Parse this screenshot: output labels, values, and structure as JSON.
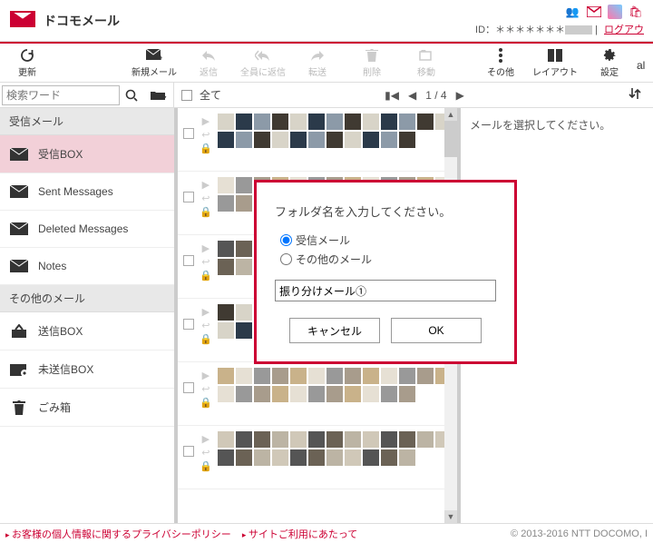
{
  "app": {
    "title": "ドコモメール"
  },
  "header": {
    "id_label": "ID：",
    "id_value": "＊＊＊＊＊＊＊",
    "logout": "ログアウ"
  },
  "toolbar": {
    "refresh": "更新",
    "compose": "新規メール",
    "reply": "返信",
    "reply_all": "全員に返信",
    "forward": "転送",
    "delete": "削除",
    "move": "移動",
    "other": "その他",
    "layout": "レイアウト",
    "settings": "設定",
    "extra": "al"
  },
  "search": {
    "placeholder": "検索ワード"
  },
  "list_header": {
    "all": "全て",
    "pager": "1 / 4"
  },
  "sidebar": {
    "group1_title": "受信メール",
    "items1": [
      {
        "label": "受信BOX"
      },
      {
        "label": "Sent Messages"
      },
      {
        "label": "Deleted Messages"
      },
      {
        "label": "Notes"
      }
    ],
    "group2_title": "その他のメール",
    "items2": [
      {
        "label": "送信BOX"
      },
      {
        "label": "未送信BOX"
      },
      {
        "label": "ごみ箱"
      }
    ]
  },
  "preview": {
    "empty": "メールを選択してください。"
  },
  "modal": {
    "title": "フォルダ名を入力してください。",
    "radio1": "受信メール",
    "radio2": "その他のメール",
    "input_value": "振り分けメール①",
    "cancel": "キャンセル",
    "ok": "OK"
  },
  "footer": {
    "link1": "お客様の個人情報に関するプライバシーポリシー",
    "link2": "サイトご利用にあたって",
    "copyright": "© 2013-2016 NTT DOCOMO, I"
  },
  "mosaic": {
    "palette": [
      "#d8d4c8",
      "#a89c8c",
      "#555",
      "#2b3a4a",
      "#c9b28a",
      "#6b6255",
      "#8c9aa8",
      "#e6e0d4",
      "#bcb4a4",
      "#403a32",
      "#999",
      "#d0c8b8"
    ]
  }
}
